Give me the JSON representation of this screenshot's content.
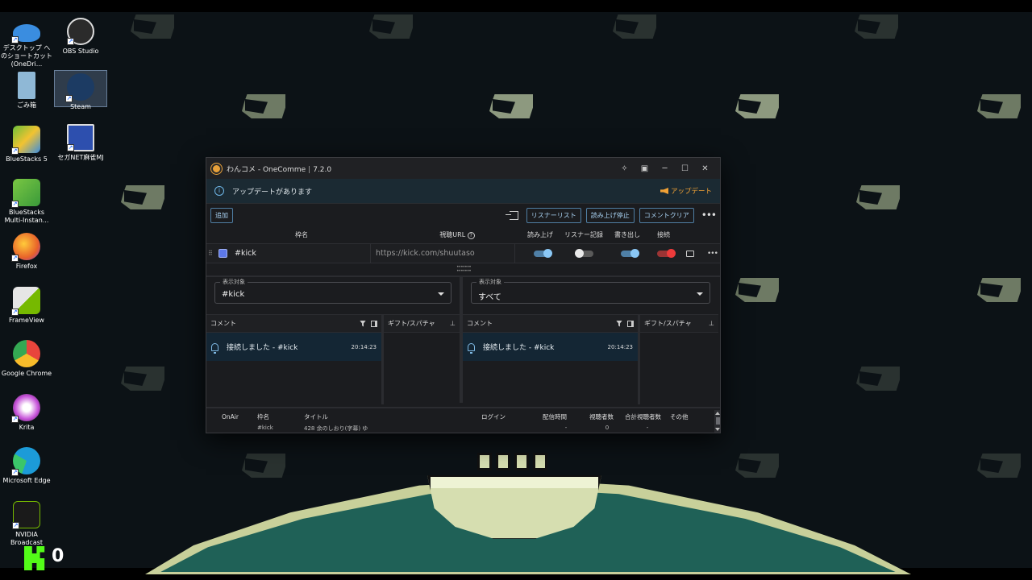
{
  "desktop": {
    "icons": [
      {
        "label": "デスクトップ へのショートカット (OneDri...",
        "icon": "onedrive-icon",
        "color": "#3a8de0"
      },
      {
        "label": "OBS Studio",
        "icon": "obs-icon",
        "color": "#2b2b2b"
      },
      {
        "label": "ごみ箱",
        "icon": "recycle-bin-icon",
        "color": "#8fb8d6"
      },
      {
        "label": "Steam",
        "icon": "steam-icon",
        "color": "#1c3b63"
      },
      {
        "label": "BlueStacks 5",
        "icon": "bluestacks-icon",
        "color": "#6bbf3a"
      },
      {
        "label": "セガNET麻雀MJ",
        "icon": "sega-mj-icon",
        "color": "#2d4fae"
      },
      {
        "label": "BlueStacks Multi-Instan...",
        "icon": "bluestacks-multi-icon",
        "color": "#7ac743"
      },
      {
        "label": "Firefox",
        "icon": "firefox-icon",
        "color": "#e8622a"
      },
      {
        "label": "FrameView",
        "icon": "frameview-icon",
        "color": "#e6e6e6"
      },
      {
        "label": "Google Chrome",
        "icon": "chrome-icon",
        "color": "#e8453c"
      },
      {
        "label": "Krita",
        "icon": "krita-icon",
        "color": "#c54fd8"
      },
      {
        "label": "Microsoft Edge",
        "icon": "edge-icon",
        "color": "#1c9bd8"
      },
      {
        "label": "NVIDIA Broadcast",
        "icon": "nvidia-broadcast-icon",
        "color": "#76b900"
      }
    ],
    "kick_overlay": {
      "count": "0",
      "color": "#53fc18"
    }
  },
  "window": {
    "app_name": "わんコメ - OneComme",
    "version": "7.2.0",
    "update_bar": {
      "message": "アップデートがあります",
      "link": "アップデート"
    },
    "toolbar": {
      "add": "追加",
      "listener_list": "リスナーリスト",
      "stop_reading": "読み上げ停止",
      "clear_comments": "コメントクリア"
    },
    "source_table": {
      "headers": {
        "name": "枠名",
        "url": "視聴URL",
        "read": "読み上げ",
        "listener_log": "リスナー記録",
        "export": "書き出し",
        "connect": "接続"
      },
      "row": {
        "name": "#kick",
        "url": "https://kick.com/shuutaso",
        "color": "#5d78e8",
        "read": true,
        "listener_log": false,
        "export": true,
        "connect": true
      }
    },
    "panels": [
      {
        "target_label": "表示対象",
        "target_value": "#kick",
        "comment_header": "コメント",
        "gift_header": "ギフト/スパチャ",
        "message": {
          "text": "接続しました - #kick",
          "time": "20:14:23"
        }
      },
      {
        "target_label": "表示対象",
        "target_value": "すべて",
        "comment_header": "コメント",
        "gift_header": "ギフト/スパチャ",
        "message": {
          "text": "接続しました - #kick",
          "time": "20:14:23"
        }
      }
    ],
    "bottom_table": {
      "headers": [
        "OnAir",
        "枠名",
        "タイトル",
        "ログイン",
        "配信時間",
        "視聴者数",
        "合計視聴者数",
        "その他"
      ],
      "row": [
        "",
        "#kick",
        "428 余のしおり(字幕) ゆ",
        "",
        "-",
        "0",
        "-",
        ""
      ]
    }
  }
}
